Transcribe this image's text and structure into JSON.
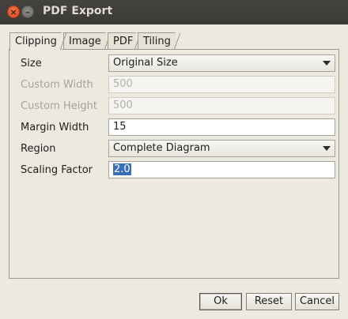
{
  "window": {
    "title": "PDF Export"
  },
  "tabs": [
    {
      "label": "Clipping",
      "active": true
    },
    {
      "label": "Image",
      "active": false
    },
    {
      "label": "PDF",
      "active": false
    },
    {
      "label": "Tiling",
      "active": false
    }
  ],
  "form": {
    "size": {
      "label": "Size",
      "value": "Original Size"
    },
    "custom_width": {
      "label": "Custom Width",
      "value": "500",
      "disabled": true
    },
    "custom_height": {
      "label": "Custom Height",
      "value": "500",
      "disabled": true
    },
    "margin_width": {
      "label": "Margin Width",
      "value": "15"
    },
    "region": {
      "label": "Region",
      "value": "Complete Diagram"
    },
    "scaling_factor": {
      "label": "Scaling Factor",
      "value": "2.0",
      "selected": true
    }
  },
  "buttons": {
    "ok": "Ok",
    "reset": "Reset",
    "cancel": "Cancel"
  },
  "icons": {
    "close": "close-icon",
    "minimize": "minimize-icon",
    "dropdown": "chevron-down-icon"
  }
}
